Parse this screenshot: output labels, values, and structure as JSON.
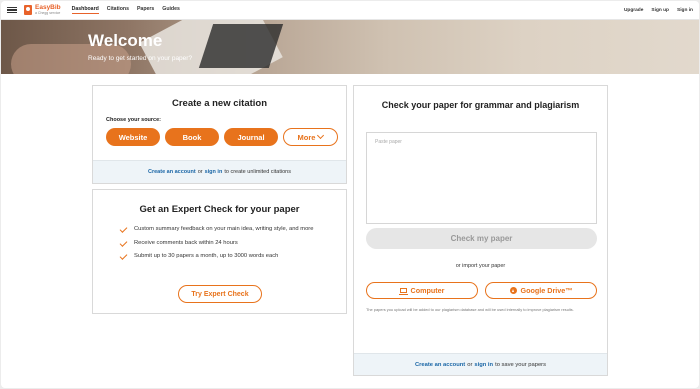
{
  "nav": {
    "brand_name": "EasyBib",
    "brand_sub": "a Chegg service",
    "links": [
      "Dashboard",
      "Citations",
      "Papers",
      "Guides"
    ],
    "right_links": [
      "Upgrade",
      "Sign up",
      "Sign in"
    ]
  },
  "hero": {
    "title": "Welcome",
    "subtitle": "Ready to get started on your paper?"
  },
  "citation_card": {
    "title": "Create a new citation",
    "source_label": "Choose your source:",
    "sources": [
      "Website",
      "Book",
      "Journal",
      "More"
    ],
    "footer_link1": "Create an account",
    "footer_or": "or",
    "footer_link2": "sign in",
    "footer_text": "to create unlimited citations"
  },
  "expert_card": {
    "title": "Get an Expert Check for your paper",
    "items": [
      "Custom summary feedback on your main idea, writing style, and more",
      "Receive comments back within 24 hours",
      "Submit up to 30 papers a month, up to 3000 words each"
    ],
    "button": "Try Expert Check"
  },
  "grammar_card": {
    "title": "Check your paper for grammar and plagiarism",
    "paste_placeholder": "Paste paper",
    "check_button": "Check my paper",
    "or_import": "or import your paper",
    "import_computer": "Computer",
    "import_drive": "Google Drive™",
    "disclaimer": "The papers you upload will be added to our plagiarism database and will be used internally to improve plagiarism results.",
    "footer_link1": "Create an account",
    "footer_or": "or",
    "footer_link2": "sign in",
    "footer_text": "to save your papers"
  },
  "colors": {
    "accent": "#e8731c",
    "link": "#1a66a6",
    "footer_bg": "#eef4f8"
  }
}
